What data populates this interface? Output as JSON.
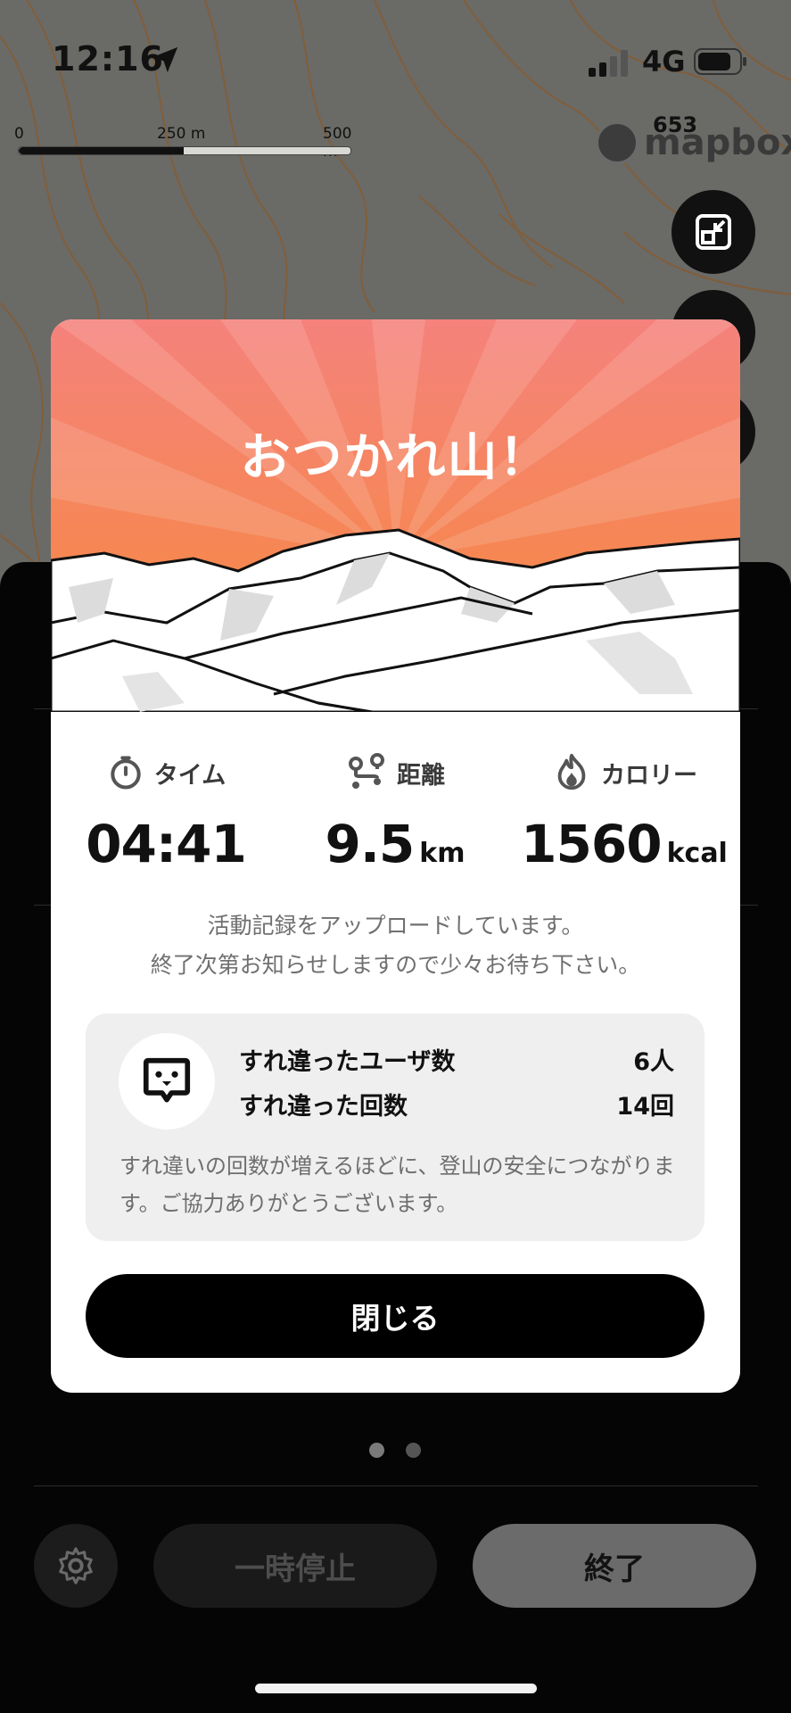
{
  "status_bar": {
    "time": "12:16",
    "network": "4G"
  },
  "map": {
    "scale_labels": [
      "0",
      "250 m",
      "500 m"
    ],
    "elevation_label": "653",
    "attribution": "mapbox"
  },
  "modal": {
    "title": "おつかれ山！",
    "stats": [
      {
        "label": "タイム",
        "value": "04:41",
        "unit": "",
        "icon": "stopwatch-icon"
      },
      {
        "label": "距離",
        "value": "9.5",
        "unit": "km",
        "icon": "route-icon"
      },
      {
        "label": "カロリー",
        "value": "1560",
        "unit": "kcal",
        "icon": "flame-icon"
      }
    ],
    "upload_message_line1": "活動記録をアップロードしています。",
    "upload_message_line2": "終了次第お知らせしますので少々お待ち下さい。",
    "passing": {
      "users_label": "すれ違ったユーザ数",
      "users_value": "6人",
      "count_label": "すれ違った回数",
      "count_value": "14回",
      "note": "すれ違いの回数が増えるほどに、登山の安全につながります。ご協力ありがとうございます。"
    },
    "close_label": "閉じる"
  },
  "sheet": {
    "pause_label": "一時停止",
    "end_label": "終了",
    "page_dots": 2,
    "active_dot": 0
  },
  "colors": {
    "hero_gradient_top": "#f5827c",
    "hero_gradient_bottom": "#f68a38",
    "button_black": "#000000"
  }
}
